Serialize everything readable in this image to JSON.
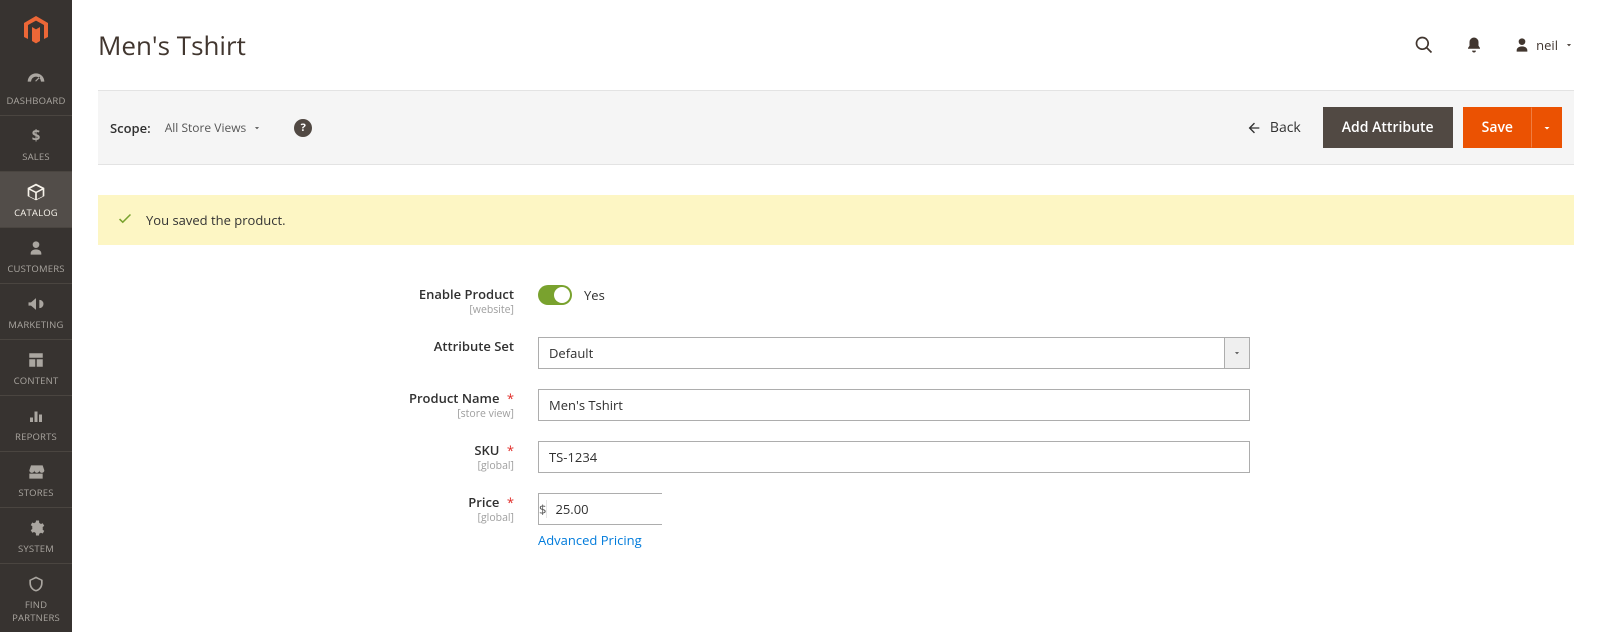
{
  "brand": {
    "color": "#ec6737"
  },
  "sidebar": {
    "active_index": 2,
    "items": [
      {
        "label": "DASHBOARD"
      },
      {
        "label": "SALES"
      },
      {
        "label": "CATALOG"
      },
      {
        "label": "CUSTOMERS"
      },
      {
        "label": "MARKETING"
      },
      {
        "label": "CONTENT"
      },
      {
        "label": "REPORTS"
      },
      {
        "label": "STORES"
      },
      {
        "label": "SYSTEM"
      },
      {
        "label": "FIND PARTNERS"
      }
    ]
  },
  "header": {
    "title": "Men's Tshirt",
    "user": "neil"
  },
  "scope": {
    "label": "Scope:",
    "value": "All Store Views"
  },
  "actions": {
    "back": "Back",
    "add_attribute": "Add Attribute",
    "save": "Save"
  },
  "messages": {
    "success": "You saved the product."
  },
  "form": {
    "enable_product": {
      "label": "Enable Product",
      "hint": "[website]",
      "value_text": "Yes"
    },
    "attribute_set": {
      "label": "Attribute Set",
      "value": "Default"
    },
    "product_name": {
      "label": "Product Name",
      "hint": "[store view]",
      "value": "Men's Tshirt"
    },
    "sku": {
      "label": "SKU",
      "hint": "[global]",
      "value": "TS-1234"
    },
    "price": {
      "label": "Price",
      "hint": "[global]",
      "currency": "$",
      "value": "25.00",
      "advanced_link": "Advanced Pricing"
    }
  }
}
